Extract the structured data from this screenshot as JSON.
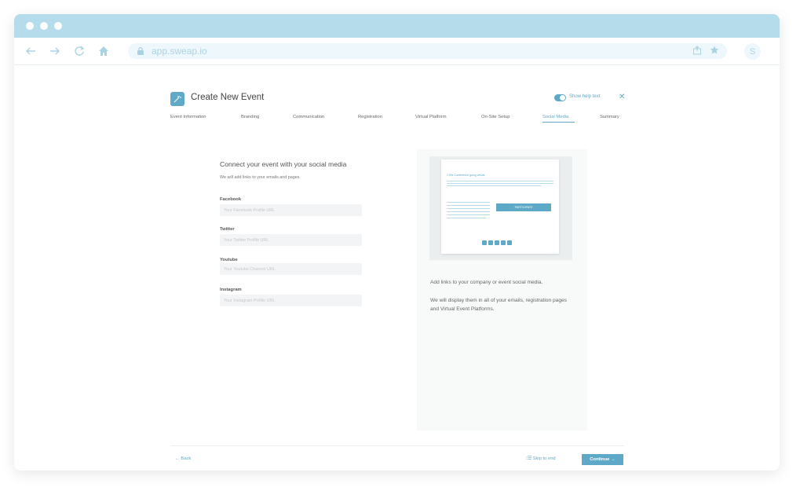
{
  "browser": {
    "url": "app.sweap.io",
    "avatar_initial": "S",
    "icons": [
      "back-arrow-icon",
      "forward-arrow-icon",
      "reload-icon",
      "home-icon",
      "lock-icon",
      "share-icon",
      "star-icon"
    ]
  },
  "header": {
    "title": "Create New Event",
    "help_toggle_label": "Show help text",
    "help_toggle_on": true,
    "close_glyph": "✕"
  },
  "tabs": [
    {
      "label": "Event Information",
      "active": false
    },
    {
      "label": "Branding",
      "active": false
    },
    {
      "label": "Communication",
      "active": false
    },
    {
      "label": "Registration",
      "active": false
    },
    {
      "label": "Virtual Platform",
      "active": false
    },
    {
      "label": "On-Site Setup",
      "active": false
    },
    {
      "label": "Social Media",
      "active": true
    },
    {
      "label": "Summary",
      "active": false
    }
  ],
  "form": {
    "title": "Connect your event with your social media",
    "subtitle": "We will add links to your emails and pages",
    "fields": [
      {
        "label": "Facebook",
        "placeholder": "Your Facebook Profile URL",
        "value": ""
      },
      {
        "label": "Twitter",
        "placeholder": "Your Twitter Profile URL",
        "value": ""
      },
      {
        "label": "Youtube",
        "placeholder": "Your Youtube Channel URL",
        "value": ""
      },
      {
        "label": "Instagram",
        "placeholder": "Your Instagram Profile URL",
        "value": ""
      }
    ]
  },
  "help": {
    "preview_title": "CSW Conference going virtual",
    "preview_button": "PARTICIPATE",
    "text_1": "Add links to your company or event social media.",
    "text_2": "We will display them in all of your emails, registration pages and Virtual Event Platforms."
  },
  "footer": {
    "back_label": "← Back",
    "skip_label": "⁝☰ Skip to end",
    "continue_label": "Continue →"
  },
  "colors": {
    "accent": "#5ea9c8",
    "titlebar": "#b5dcea",
    "url_bg": "#eef7fb"
  }
}
